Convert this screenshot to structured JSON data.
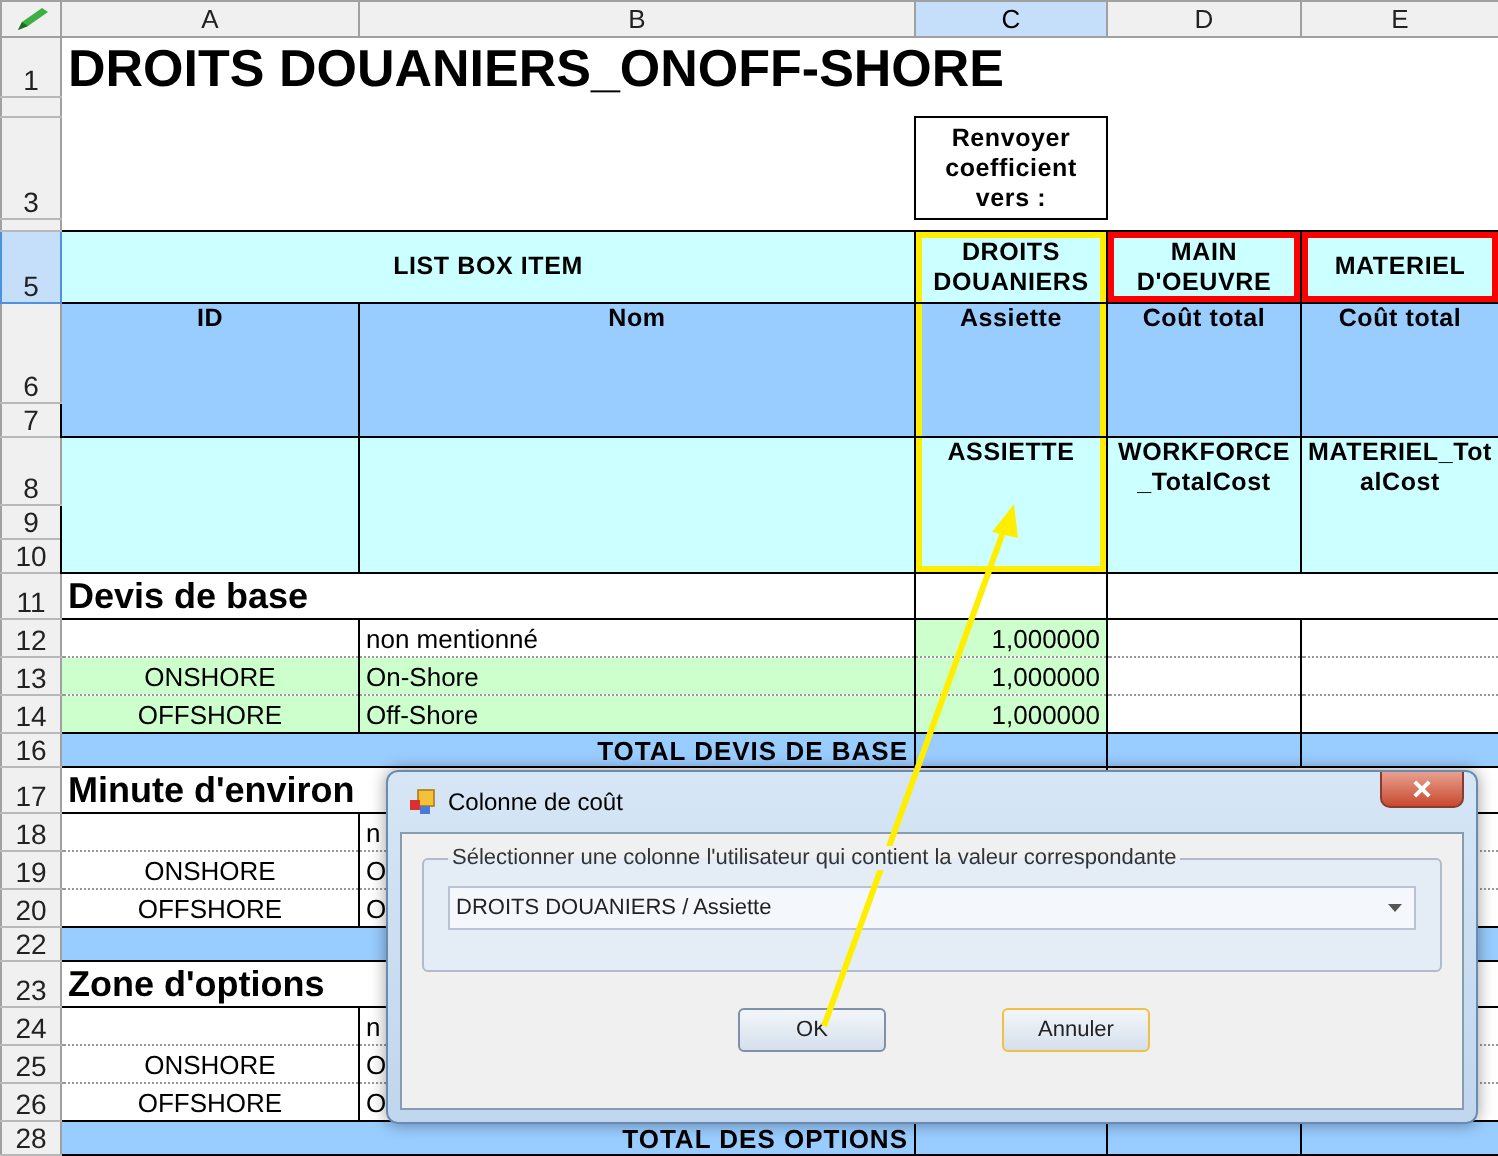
{
  "columns": [
    {
      "label": "A",
      "selected": false
    },
    {
      "label": "B",
      "selected": false
    },
    {
      "label": "C",
      "selected": true
    },
    {
      "label": "D",
      "selected": false
    },
    {
      "label": "E",
      "selected": false
    }
  ],
  "header_rows": [
    {
      "label": "1",
      "selected": false
    },
    {
      "selected": false
    },
    {
      "label": "3",
      "selected": false
    },
    {
      "selected": false
    },
    {
      "label": "5",
      "selected": true
    },
    {
      "label": "6",
      "selected": false
    },
    {
      "label": "7",
      "selected": false
    },
    {
      "label": "8",
      "selected": false
    },
    {
      "label": "9",
      "selected": false
    },
    {
      "label": "10",
      "selected": false
    }
  ],
  "title": "DROITS DOUANIERS_ONOFF-SHORE",
  "return_label": "Renvoyer coefficient vers :",
  "list_box_header": "LIST BOX ITEM",
  "id_header": "ID",
  "name_header": "Nom",
  "target_columns": [
    {
      "label": "DROITS DOUANIERS",
      "kind": "column-frame",
      "color": "#ffee00",
      "field": "Assiette",
      "code": "ASSIETTE"
    },
    {
      "label": "MAIN D'OEUVRE",
      "kind": "cell-frame",
      "color": "#ff0000",
      "field": "Coût total",
      "code": "WORKFORCE _TotalCost"
    },
    {
      "label": "MATERIEL",
      "kind": "cell-frame",
      "color": "#ff0000",
      "field": "Coût total",
      "code": "MATERIEL_TotalCost"
    }
  ],
  "sections": [
    {
      "number": "11",
      "title": "Devis de base",
      "rows": [
        {
          "number": "12",
          "name": "non mentionné",
          "value": "1,000000",
          "highlighted": false
        },
        {
          "number": "13",
          "id": "ONSHORE",
          "name": "On-Shore",
          "value": "1,000000",
          "highlighted": true
        },
        {
          "number": "14",
          "id": "OFFSHORE",
          "name": "Off-Shore",
          "value": "1,000000",
          "highlighted": true
        }
      ],
      "total": {
        "number": "16",
        "label": "TOTAL DEVIS DE BASE"
      }
    },
    {
      "number": "17",
      "title": "Minute d'environ",
      "rows": [
        {
          "number": "18",
          "name": "n",
          "highlighted": false
        },
        {
          "number": "19",
          "id": "ONSHORE",
          "name": "O",
          "highlighted": false
        },
        {
          "number": "20",
          "id": "OFFSHORE",
          "name": "O",
          "highlighted": false
        }
      ],
      "total": {
        "number": "22"
      }
    },
    {
      "number": "23",
      "title": "Zone d'options",
      "rows": [
        {
          "number": "24",
          "name": "n",
          "highlighted": false
        },
        {
          "number": "25",
          "id": "ONSHORE",
          "name": "O",
          "highlighted": false
        },
        {
          "number": "26",
          "id": "OFFSHORE",
          "name": "O",
          "highlighted": false
        }
      ],
      "total": {
        "number": "28",
        "label": "TOTAL DES OPTIONS"
      }
    }
  ],
  "dialog": {
    "title": "Colonne de coût",
    "group_label": "Sélectionner une colonne l'utilisateur qui contient la valeur correspondante",
    "combo_value": "DROITS DOUANIERS / Assiette",
    "buttons": [
      {
        "label": "OK",
        "focused": false
      },
      {
        "label": "Annuler",
        "focused": true
      }
    ]
  }
}
